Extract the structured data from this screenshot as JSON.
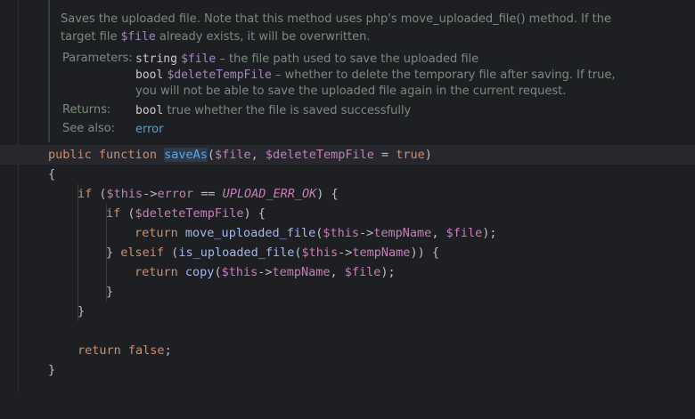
{
  "doc": {
    "summary_parts": [
      "Saves the uploaded file. Note that this method uses php's move_uploaded_file() method. If the target file ",
      "$file",
      " already exists, it will be overwritten."
    ],
    "params_label": "Parameters:",
    "params": [
      {
        "type": "string",
        "name": "$file",
        "desc": " – the file path used to save the uploaded file"
      },
      {
        "type": "bool",
        "name": "$deleteTempFile",
        "desc": " – whether to delete the temporary file after saving. If true,"
      }
    ],
    "params_cont": "you will not be able to save the uploaded file again in the current request.",
    "returns_label": "Returns:",
    "returns_type": "bool",
    "returns_desc": " true whether the file is saved successfully",
    "see_label": "See also:",
    "see_link": "error"
  },
  "code": {
    "kw_public": "public",
    "kw_function": "function",
    "method": "saveAs",
    "param1": "$file",
    "param2": "$deleteTempFile",
    "default_val": "true",
    "open_brace": "{",
    "close_brace": "}",
    "kw_if": "if",
    "kw_elseif": "elseif",
    "kw_return": "return",
    "this": "$this",
    "arrow": "->",
    "prop_error": "error",
    "prop_tempName": "tempName",
    "const_ok": "UPLOAD_ERR_OK",
    "fn_move": "move_uploaded_file",
    "fn_is_uploaded": "is_uploaded_file",
    "fn_copy": "copy",
    "kw_false": "false"
  }
}
